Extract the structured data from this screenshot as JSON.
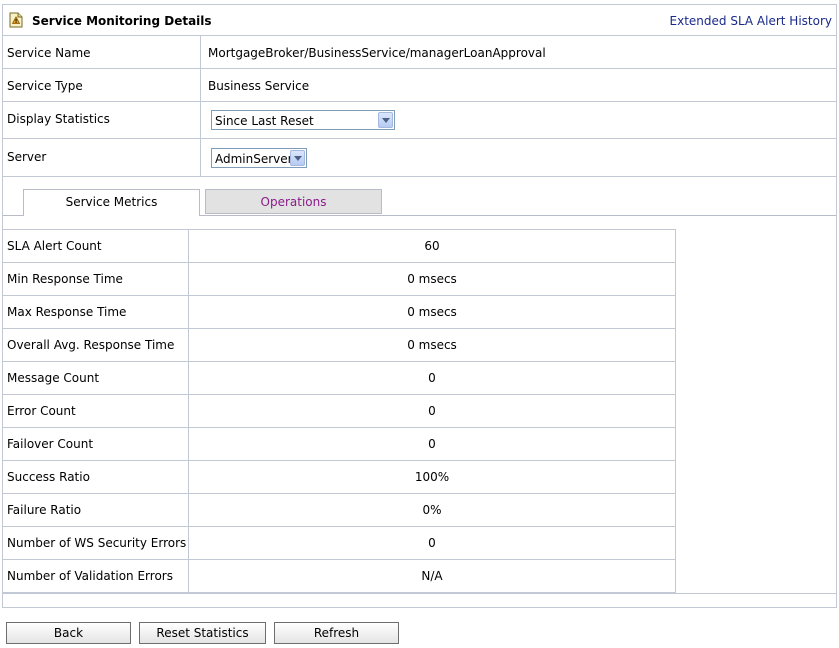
{
  "header": {
    "title": "Service Monitoring Details",
    "icon": "document-alert-icon",
    "link_label": "Extended SLA Alert History"
  },
  "info": {
    "service_name_label": "Service Name",
    "service_name_value": "MortgageBroker/BusinessService/managerLoanApproval",
    "service_type_label": "Service Type",
    "service_type_value": "Business Service",
    "display_statistics_label": "Display Statistics",
    "display_statistics_value": "Since Last Reset",
    "server_label": "Server",
    "server_value": "AdminServer"
  },
  "tabs": [
    {
      "label": "Service Metrics",
      "active": true
    },
    {
      "label": "Operations",
      "active": false
    }
  ],
  "metrics": [
    {
      "label": "SLA Alert Count",
      "value": "60"
    },
    {
      "label": "Min Response Time",
      "value": "0 msecs"
    },
    {
      "label": "Max Response Time",
      "value": "0 msecs"
    },
    {
      "label": "Overall Avg. Response Time",
      "value": "0 msecs"
    },
    {
      "label": "Message Count",
      "value": "0"
    },
    {
      "label": "Error Count",
      "value": "0"
    },
    {
      "label": "Failover Count",
      "value": "0"
    },
    {
      "label": "Success Ratio",
      "value": "100%"
    },
    {
      "label": "Failure Ratio",
      "value": "0%"
    },
    {
      "label": "Number of WS Security Errors",
      "value": "0"
    },
    {
      "label": "Number of Validation Errors",
      "value": "N/A"
    }
  ],
  "buttons": {
    "back": "Back",
    "reset": "Reset Statistics",
    "refresh": "Refresh"
  },
  "colors": {
    "border": "#c2c8d4",
    "link": "#1a2a8a",
    "inactive_tab_text": "#8a1b8a",
    "inactive_tab_bg": "#e2e2e2"
  }
}
